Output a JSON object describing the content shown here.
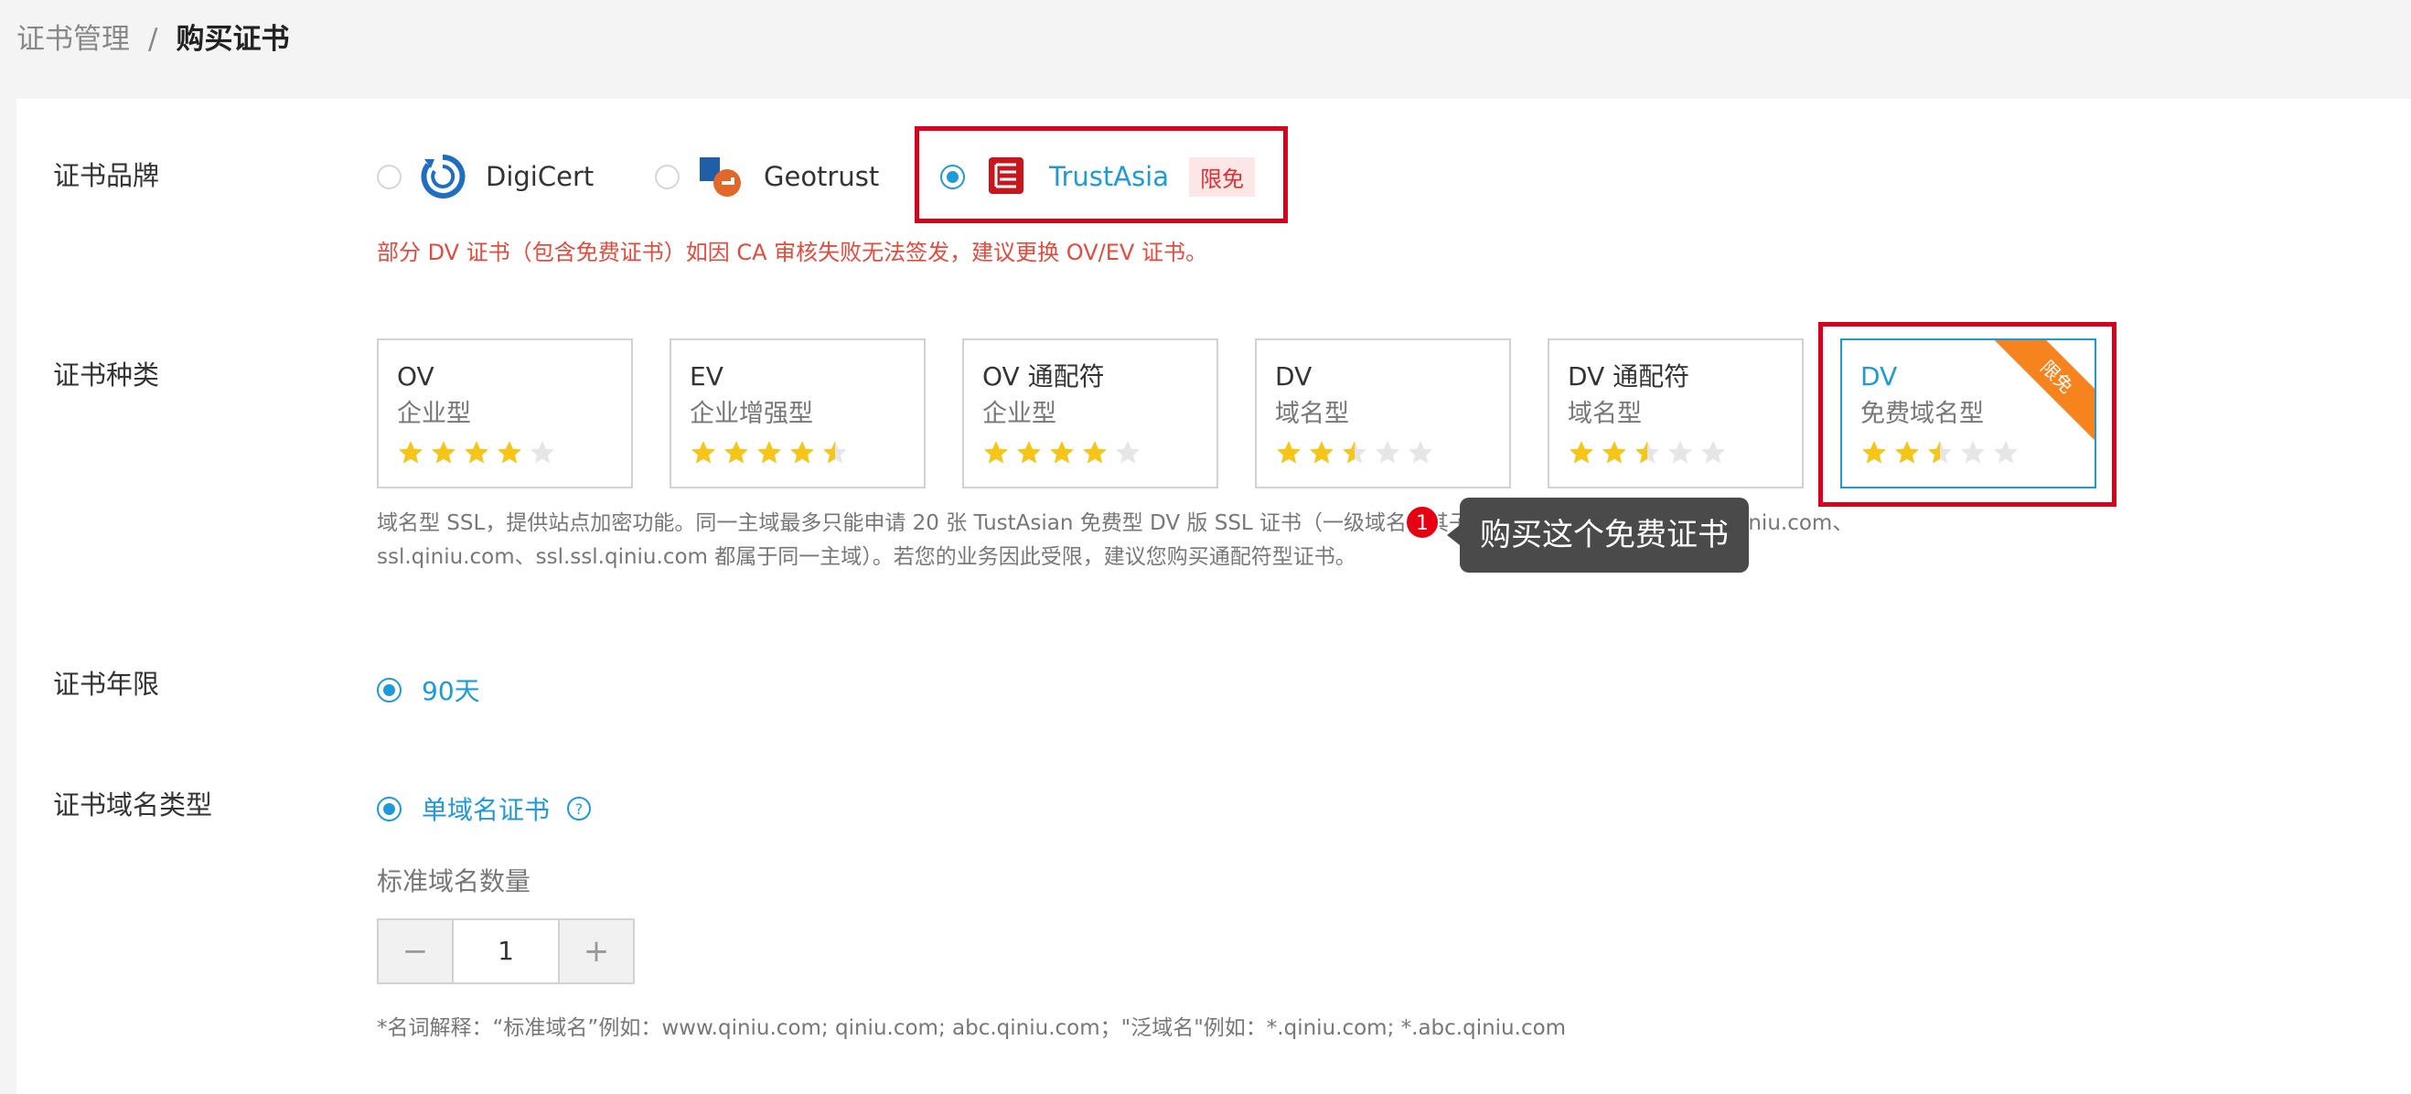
{
  "breadcrumb": {
    "parent": "证书管理",
    "separator": "/",
    "current": "购买证书"
  },
  "labels": {
    "brand": "证书品牌",
    "type": "证书种类",
    "term": "证书年限",
    "domain_type": "证书域名类型"
  },
  "brands": [
    {
      "name": "DigiCert",
      "selected": false,
      "logo": "digicert-logo"
    },
    {
      "name": "Geotrust",
      "selected": false,
      "logo": "geotrust-logo"
    },
    {
      "name": "TrustAsia",
      "selected": true,
      "logo": "trustasia-logo",
      "tag": "限免"
    }
  ],
  "brand_warning": "部分 DV 证书（包含免费证书）如因 CA 审核失败无法签发，建议更换 OV/EV 证书。",
  "cert_types": [
    {
      "title": "OV",
      "subtitle": "企业型",
      "rating": 4
    },
    {
      "title": "EV",
      "subtitle": "企业增强型",
      "rating": 4.5
    },
    {
      "title": "OV 通配符",
      "subtitle": "企业型",
      "rating": 4
    },
    {
      "title": "DV",
      "subtitle": "域名型",
      "rating": 2.5
    },
    {
      "title": "DV 通配符",
      "subtitle": "域名型",
      "rating": 2.5
    },
    {
      "title": "DV",
      "subtitle": "免费域名型",
      "rating": 2.5,
      "selected": true,
      "ribbon": "限免"
    }
  ],
  "type_description_line1": "域名型 SSL，提供站点加密功能。同一主域最多只能申请 20 张 TustAsian 免费型 DV 版 SSL 证书（一级域名及其子域名均属于同一主域，例如 qiniu.com、",
  "type_description_line2": "ssl.qiniu.com、ssl.ssl.qiniu.com 都属于同一主域）。若您的业务因此受限，建议您购买通配符型证书。",
  "tooltip": {
    "badge": "1",
    "text": "购买这个免费证书"
  },
  "term_option": "90天",
  "domain_option": "单域名证书",
  "count_label": "标准域名数量",
  "stepper": {
    "minus": "−",
    "value": "1",
    "plus": "+"
  },
  "note": "*名词解释：“标准域名”例如：www.qiniu.com; qiniu.com; abc.qiniu.com；\"泛域名\"例如：*.qiniu.com; *.abc.qiniu.com",
  "colors": {
    "accent": "#1e9bd7",
    "warning": "#e34b3f",
    "highlight": "#d9001b",
    "ribbon": "#f7831f",
    "star": "#f5c518"
  }
}
